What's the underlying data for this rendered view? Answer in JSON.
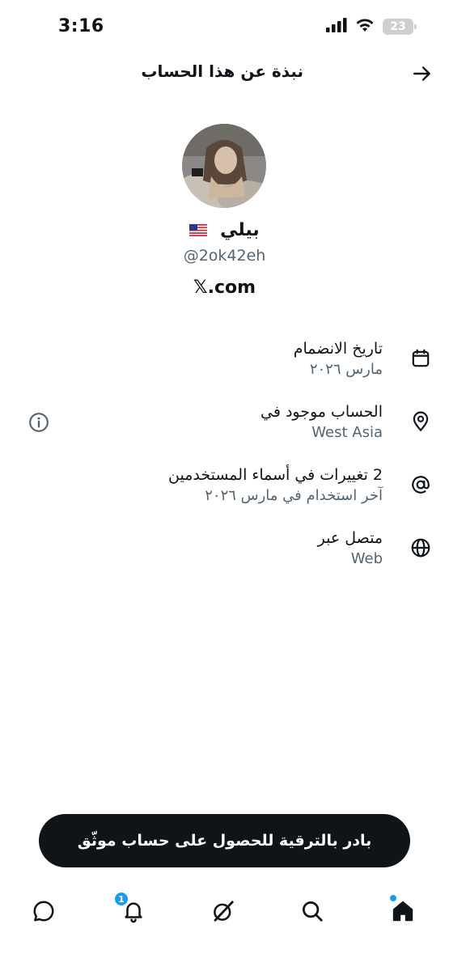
{
  "status_bar": {
    "time": "3:16",
    "battery": "23"
  },
  "header": {
    "title": "نبذة عن هذا الحساب"
  },
  "profile": {
    "name": "بيلي",
    "flag": "🇺🇸",
    "handle": "@2ok42eh",
    "site": "𝕏.com"
  },
  "info": {
    "joined_title": "تاريخ الانضمام",
    "joined_value": "مارس ٢٠٢٦",
    "location_title": "الحساب موجود في",
    "location_value": "West Asia",
    "username_title": "2 تغييرات في أسماء المستخدمين",
    "username_value": "آخر استخدام في مارس ٢٠٢٦",
    "connected_title": "متصل عبر",
    "connected_value": "Web"
  },
  "upgrade": {
    "label": "بادر بالترقية للحصول على حساب موثّق"
  },
  "nav": {
    "notifications_badge": "1"
  },
  "colors": {
    "text": "#0f1419",
    "secondary": "#536471",
    "accent": "#1d9bf0"
  }
}
